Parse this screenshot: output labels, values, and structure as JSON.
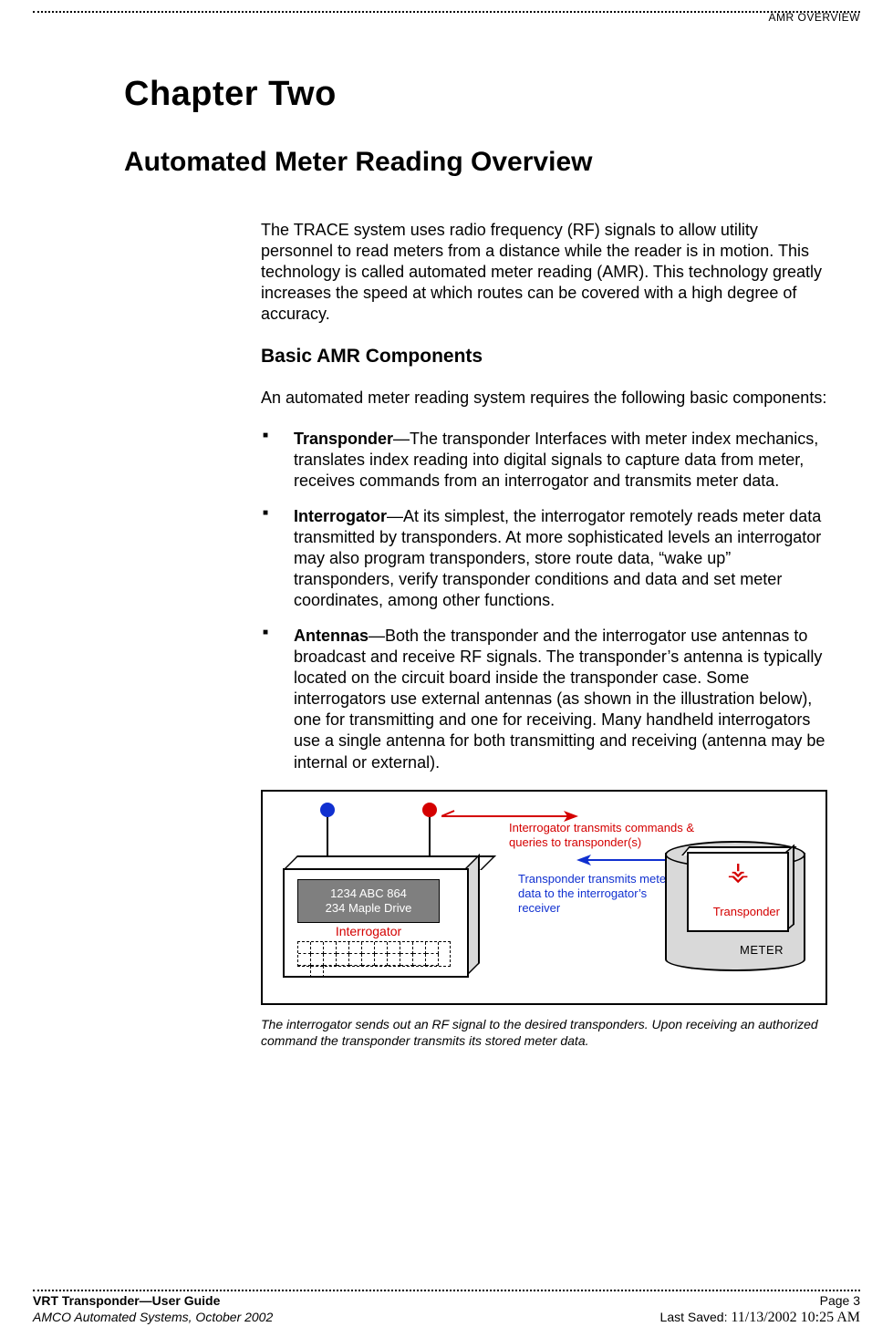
{
  "header": {
    "right": "AMR OVERVIEW"
  },
  "chapter": "Chapter Two",
  "section": "Automated Meter Reading Overview",
  "intro": "The TRACE system uses radio frequency (RF) signals to allow utility personnel to read meters from a distance while the reader is in motion. This technology is called automated meter reading (AMR). This technology greatly increases the speed at which routes can be covered with a high degree of accuracy.",
  "sub_heading": "Basic AMR Components",
  "lead_in": "An automated meter reading system requires the following basic components:",
  "bullets": [
    {
      "term": "Transponder",
      "text": "—The transponder Interfaces with meter index mechanics, translates index reading into digital signals to capture data from meter, receives commands from an interrogator and transmits meter data."
    },
    {
      "term": "Interrogator",
      "text": "—At its simplest, the interrogator remotely reads meter data transmitted by transponders. At more sophisticated levels an interrogator may also program transponders, store route data, “wake up” transponders, verify transponder conditions and data and set meter coordinates, among other functions."
    },
    {
      "term": "Antennas",
      "text": "—Both the transponder and the interrogator use antennas to broadcast and receive RF signals. The transponder’s antenna is typically located on the circuit board inside the transponder case. Some interrogators use external antennas (as shown in the illustration below), one for transmitting and one for receiving. Many handheld interrogators use a single antenna for both transmitting and receiving (antenna may be internal or external)."
    }
  ],
  "figure": {
    "screen_line1": "1234 ABC 864",
    "screen_line2": "234 Maple Drive",
    "interrogator_label": "Interrogator",
    "annot_red": "Interrogator transmits commands & queries to transponder(s)",
    "annot_blue": "Transponder transmits meter data to the interrogator’s receiver",
    "transponder_label": "Transponder",
    "meter_label": "METER"
  },
  "caption": "The interrogator sends out an RF signal to the desired transponders. Upon receiving an authorized command the transponder transmits its stored meter data.",
  "footer": {
    "guide": "VRT Transponder—User Guide",
    "page": "Page 3",
    "org": "AMCO Automated Systems, October 2002",
    "last_saved_label": "Last Saved: ",
    "last_saved_value": "11/13/2002 10:25 AM"
  }
}
